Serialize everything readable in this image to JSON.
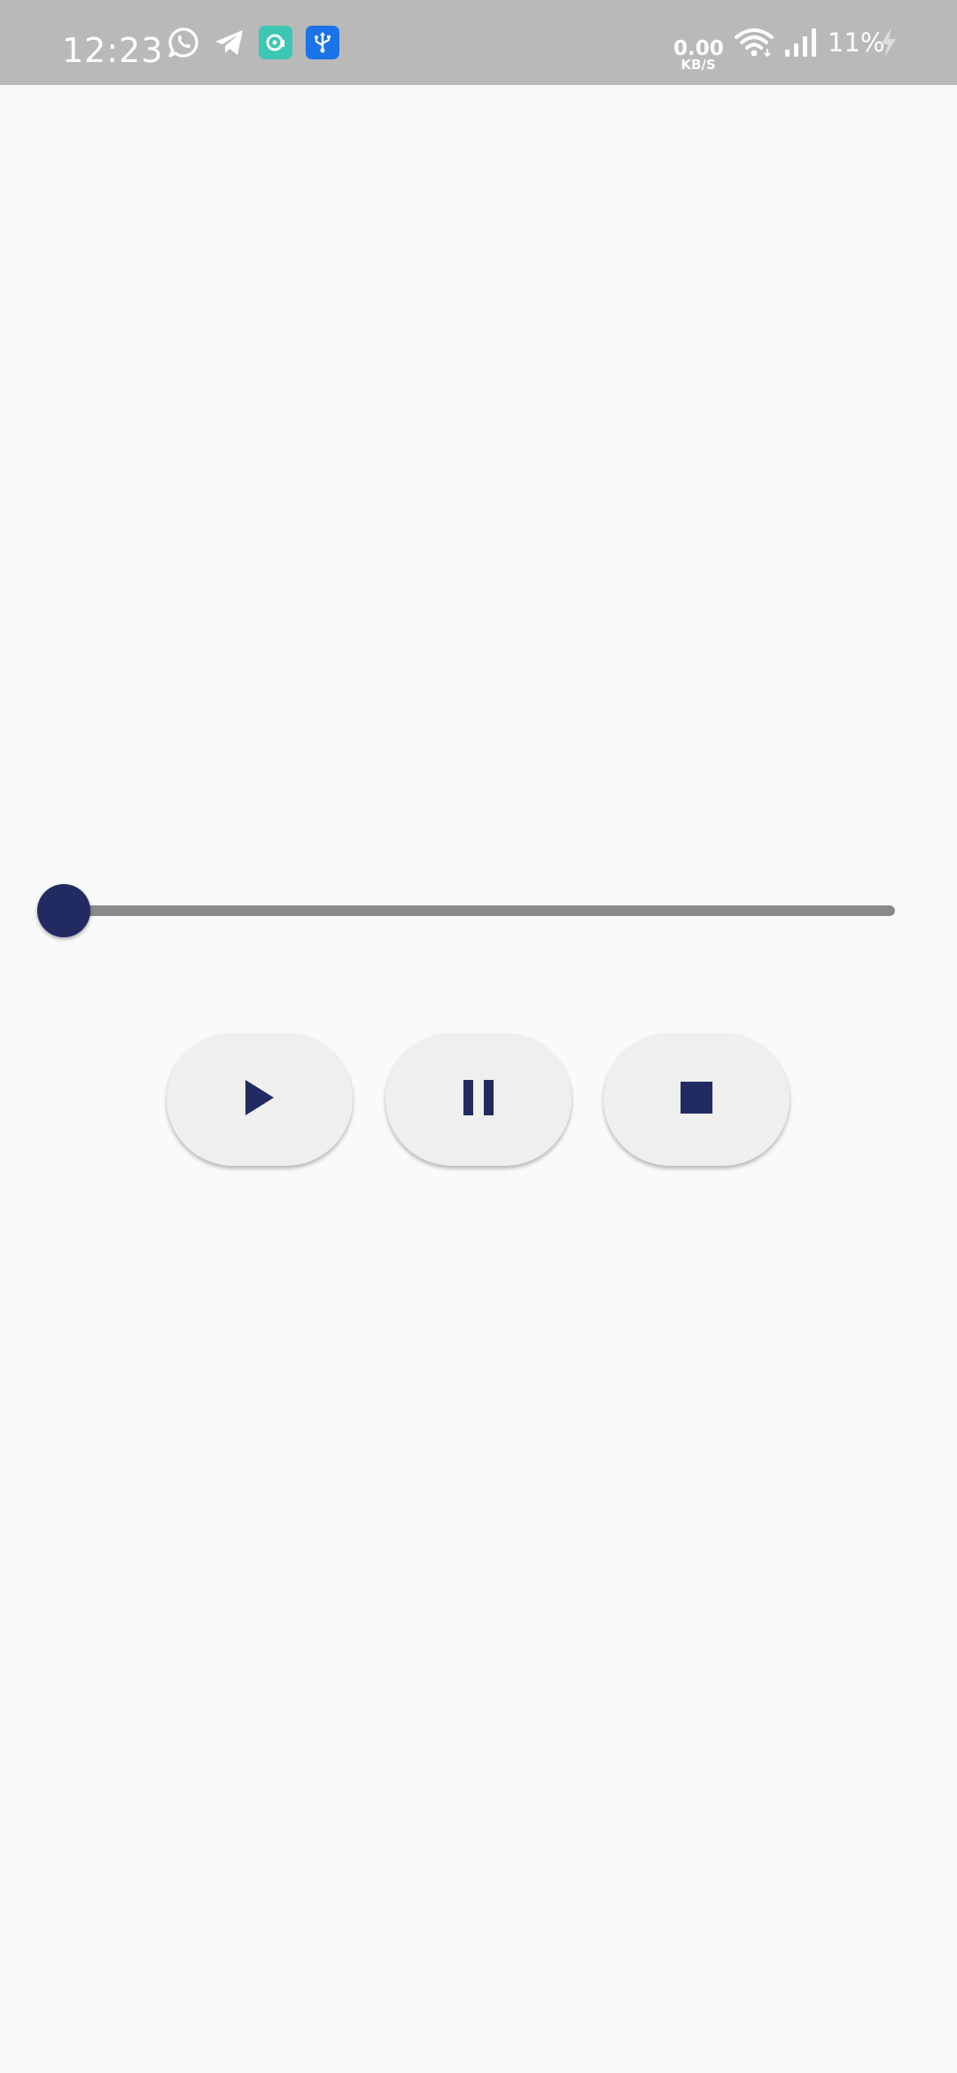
{
  "status_bar": {
    "time": "12:23",
    "net_speed_value": "0.00",
    "net_speed_unit": "KB/S",
    "battery": "11%",
    "notification_icons": [
      "whatsapp-icon",
      "telegram-icon",
      "app-notification-icon",
      "usb-icon"
    ],
    "system_icons": [
      "wifi-icon",
      "signal-icon",
      "charging-bolt-icon"
    ]
  },
  "player": {
    "progress": 0,
    "controls": [
      "play-icon",
      "pause-icon",
      "stop-icon"
    ]
  },
  "colors": {
    "accent": "#222b61",
    "status_bar_bg": "#b9b9b9",
    "background": "#fafafa",
    "button_bg": "#efefef",
    "track": "#8b8b8b"
  }
}
